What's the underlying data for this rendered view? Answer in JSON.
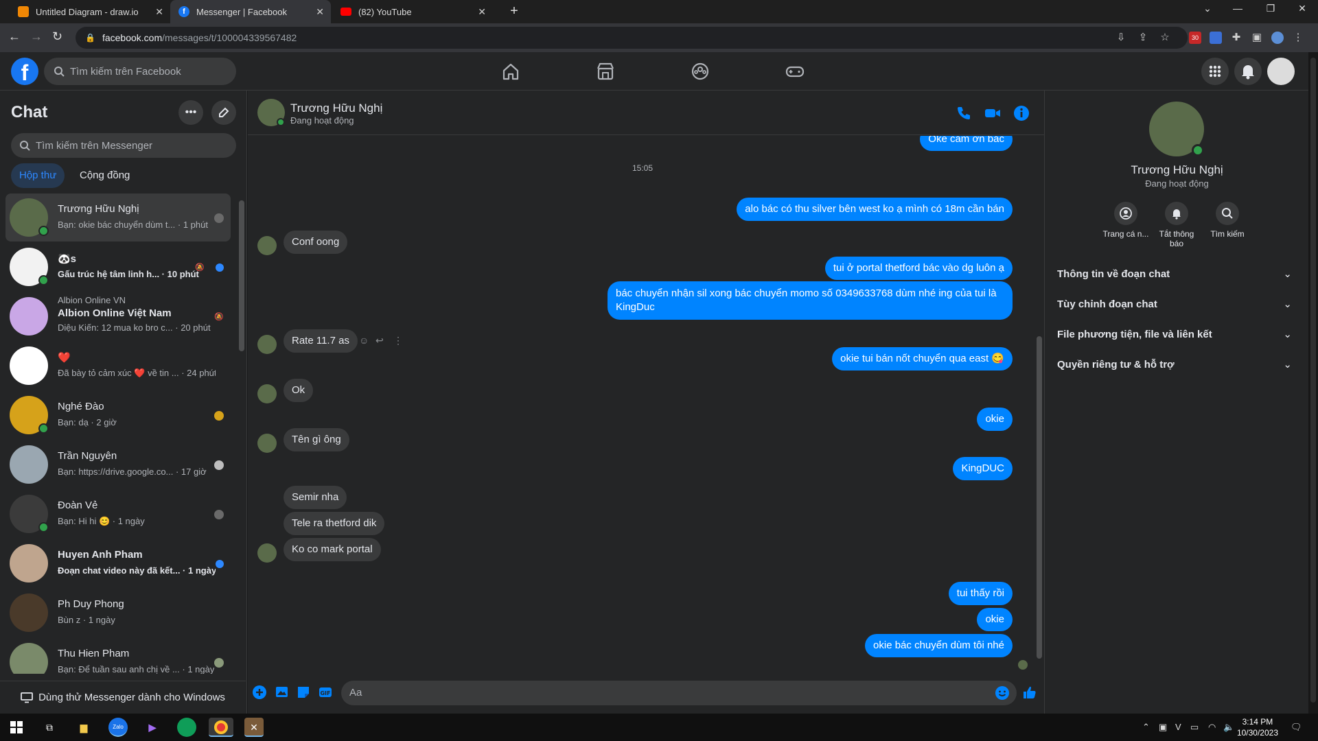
{
  "browser": {
    "tabs": [
      {
        "title": "Untitled Diagram - draw.io",
        "favicon": "drawio-icon",
        "color": "#f08705"
      },
      {
        "title": "Messenger | Facebook",
        "favicon": "facebook-icon",
        "color": "#1877f2"
      },
      {
        "title": "(82) YouTube",
        "favicon": "youtube-icon",
        "color": "#ff0000"
      }
    ],
    "url_domain": "facebook.com",
    "url_path": "/messages/t/100004339567482"
  },
  "facebook": {
    "search_placeholder": "Tìm kiếm trên Facebook"
  },
  "sidebar": {
    "title": "Chat",
    "search_placeholder": "Tìm kiếm trên Messenger",
    "tabs": [
      "Hộp thư",
      "Cộng đồng"
    ],
    "conversations": [
      {
        "name": "Trương Hữu Nghị",
        "preview": "Bạn: okie bác chuyển dùm t... · 1 phút",
        "online": true,
        "active": true,
        "avatar_color": "#5a6b4a"
      },
      {
        "name": "🐼s",
        "preview": "Gấu trúc hệ tâm linh h... · 10 phút",
        "online": true,
        "unread": true,
        "avatar_color": "#f2f2f2"
      },
      {
        "group": "Albion Online VN",
        "name": "Albion Online Việt Nam",
        "preview": "Diệu Kiến: 12 mua ko bro c... · 20 phút",
        "avatar_color": "#c9a7e6"
      },
      {
        "name": "❤️",
        "preview": "Đã bày tỏ cảm xúc ❤️ về tin ... · 24 phút",
        "avatar_color": "#ffffff"
      },
      {
        "name": "Nghé Đào",
        "preview": "Bạn: dạ · 2 giờ",
        "online": true,
        "avatar_color": "#d6a21a"
      },
      {
        "name": "Trần Nguyên",
        "preview": "Bạn: https://drive.google.co... · 17 giờ",
        "avatar_color": "#9aa7b1"
      },
      {
        "name": "Đoàn Vẻ",
        "preview": "Bạn: Hi hi 😊 · 1 ngày",
        "online": true,
        "avatar_color": "#3b3b3b"
      },
      {
        "name": "Huyen Anh Pham",
        "preview": "Đoạn chat video này đã kết... · 1 ngày",
        "unread": true,
        "avatar_color": "#bfa58e"
      },
      {
        "name": "Ph Duy Phong",
        "preview": "Bùn z · 1 ngày",
        "avatar_color": "#4a3a2a"
      },
      {
        "name": "Thu Hien Pham",
        "preview": "Bạn: Để tuần sau anh chị về ... · 1 ngày",
        "avatar_color": "#7a8a6a"
      }
    ],
    "try_windows": "Dùng thử Messenger dành cho Windows"
  },
  "chat": {
    "contact_name": "Trương Hữu Nghị",
    "status": "Đang hoạt động",
    "timestamp": "15:05",
    "messages": [
      {
        "dir": "out",
        "text": "Oke cảm ơn bác"
      },
      {
        "dir": "out",
        "text": "alo bác có thu silver bên west ko ạ mình có 18m cần bán"
      },
      {
        "dir": "in",
        "text": "Conf oong"
      },
      {
        "dir": "out",
        "text": "tui ở portal thetford bác vào dg luôn ạ"
      },
      {
        "dir": "out",
        "text": "bác chuyển nhận sil xong bác chuyển momo số 0349633768 dùm nhé ing của tui là KingDuc"
      },
      {
        "dir": "in",
        "text": "Rate 11.7 as"
      },
      {
        "dir": "out",
        "text": "okie tui bán nốt chuyển qua east 😋"
      },
      {
        "dir": "in",
        "text": "Ok"
      },
      {
        "dir": "out",
        "text": "okie"
      },
      {
        "dir": "in",
        "text": "Tên gì ông"
      },
      {
        "dir": "out",
        "text": "KingDUC"
      },
      {
        "dir": "in",
        "text": "Semir nha"
      },
      {
        "dir": "in",
        "text": "Tele ra thetford dik"
      },
      {
        "dir": "in",
        "text": "Ko co mark portal"
      },
      {
        "dir": "out",
        "text": "tui thấy rồi"
      },
      {
        "dir": "out",
        "text": "okie"
      },
      {
        "dir": "out",
        "text": "okie bác chuyển dùm tôi nhé"
      }
    ],
    "input_placeholder": "Aa"
  },
  "info_panel": {
    "name": "Trương Hữu Nghị",
    "status": "Đang hoạt động",
    "actions": [
      "Trang cá n...",
      "Tắt thông báo",
      "Tìm kiếm"
    ],
    "sections": [
      "Thông tin về đoạn chat",
      "Tùy chỉnh đoạn chat",
      "File phương tiện, file và liên kết",
      "Quyền riêng tư & hỗ trợ"
    ]
  },
  "taskbar": {
    "time": "3:14 PM",
    "date": "10/30/2023"
  },
  "colors": {
    "accent": "#0084ff",
    "brand": "#1877f2",
    "online": "#31a24c"
  }
}
